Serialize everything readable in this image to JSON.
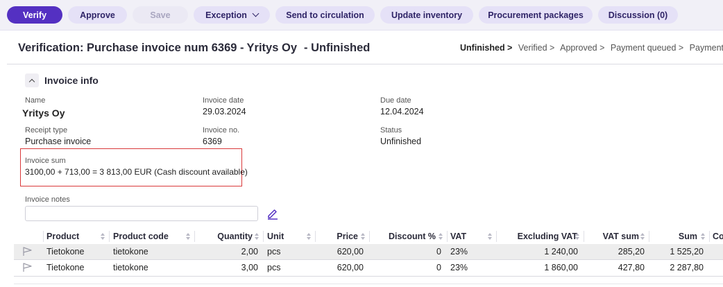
{
  "toolbar": {
    "verify": "Verify",
    "approve": "Approve",
    "save": "Save",
    "exception": "Exception",
    "send_to_circulation": "Send to circulation",
    "update_inventory": "Update inventory",
    "procurement_packages": "Procurement packages",
    "discussion": "Discussion (0)"
  },
  "header": {
    "title": "Verification: Purchase invoice num 6369 -",
    "vendor": "Yritys Oy",
    "status": "- Unfinished",
    "steps": [
      "Unfinished >",
      "Verified >",
      "Approved >",
      "Payment queued >",
      "Payment sent"
    ]
  },
  "invoice_info": {
    "section_title": "Invoice info",
    "name_label": "Name",
    "name_value": "Yritys Oy",
    "invoice_date_label": "Invoice date",
    "invoice_date_value": "29.03.2024",
    "due_date_label": "Due date",
    "due_date_value": "12.04.2024",
    "receipt_type_label": "Receipt type",
    "receipt_type_value": "Purchase invoice",
    "invoice_no_label": "Invoice no.",
    "invoice_no_value": "6369",
    "status_label": "Status",
    "status_value": "Unfinished",
    "invoice_sum_label": "Invoice sum",
    "invoice_sum_value": "3100,00 + 713,00 = 3 813,00 EUR (Cash discount available)",
    "invoice_notes_label": "Invoice notes",
    "invoice_notes_value": ""
  },
  "table": {
    "columns": [
      "Product",
      "Product code",
      "Quantity",
      "Unit",
      "Price",
      "Discount %",
      "VAT",
      "Excluding VAT",
      "VAT sum",
      "Sum",
      "Co"
    ],
    "rows": [
      [
        "Tietokone",
        "tietokone",
        "2,00",
        "pcs",
        "620,00",
        "0",
        "23%",
        "1 240,00",
        "285,20",
        "1 525,20"
      ],
      [
        "Tietokone",
        "tietokone",
        "3,00",
        "pcs",
        "620,00",
        "0",
        "23%",
        "1 860,00",
        "427,80",
        "2 287,80"
      ]
    ]
  },
  "colors": {
    "accent": "#5430c2",
    "button_bg": "#e5e1f7",
    "highlight_border": "#d9393a"
  },
  "icons": {
    "exception_dropdown": "chevron-down-icon",
    "section_toggle": "chevron-up-icon",
    "notes_edit": "pencil-icon",
    "row_flag": "flag-icon",
    "column_sort": "sort-icon"
  }
}
